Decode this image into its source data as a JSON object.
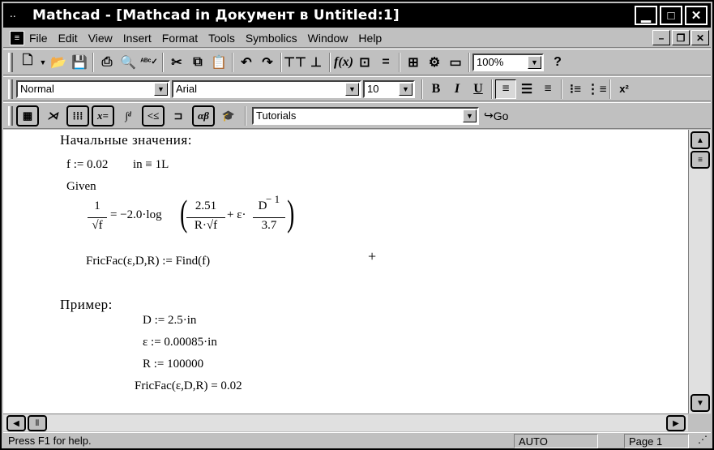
{
  "window": {
    "title": "Mathcad - [Mathcad in Документ в Untitled:1]",
    "minimize": "▁",
    "maximize": "□",
    "close": "✕"
  },
  "menu": {
    "items": [
      "File",
      "Edit",
      "View",
      "Insert",
      "Format",
      "Tools",
      "Symbolics",
      "Window",
      "Help"
    ],
    "mdi_min": "–",
    "mdi_restore": "❐",
    "mdi_close": "✕"
  },
  "standard_toolbar": {
    "zoom": "100%"
  },
  "format_toolbar": {
    "style": "Normal",
    "font": "Arial",
    "size": "10",
    "bold": "B",
    "italic": "I",
    "underline": "U",
    "superscript": "x²"
  },
  "math_toolbar": {
    "resource": "Tutorials",
    "go_label": "Go"
  },
  "worksheet": {
    "heading_initial": "Начальные значения:",
    "def_f": "f := 0.02",
    "def_in": "in ≡ 1L",
    "given": "Given",
    "eq_num": "1",
    "eq_den": "√f",
    "eq_mid": "= −2.0·log",
    "eq_inner_num": "2.51",
    "eq_inner_den": "R·√f",
    "eq_plus": "+ ε·",
    "eq_d_num": "D",
    "eq_d_exp": "− 1",
    "eq_d_den": "3.7",
    "fric_def": "FricFac(ε,D,R) := Find(f)",
    "cursor": "+",
    "heading_example": "Пример:",
    "ex_D": "D := 2.5·in",
    "ex_eps": "ε := 0.00085·in",
    "ex_R": "R := 100000",
    "ex_result": "FricFac(ε,D,R) = 0.02"
  },
  "status": {
    "help": "Press F1 for help.",
    "mode": "AUTO",
    "page": "Page 1"
  }
}
